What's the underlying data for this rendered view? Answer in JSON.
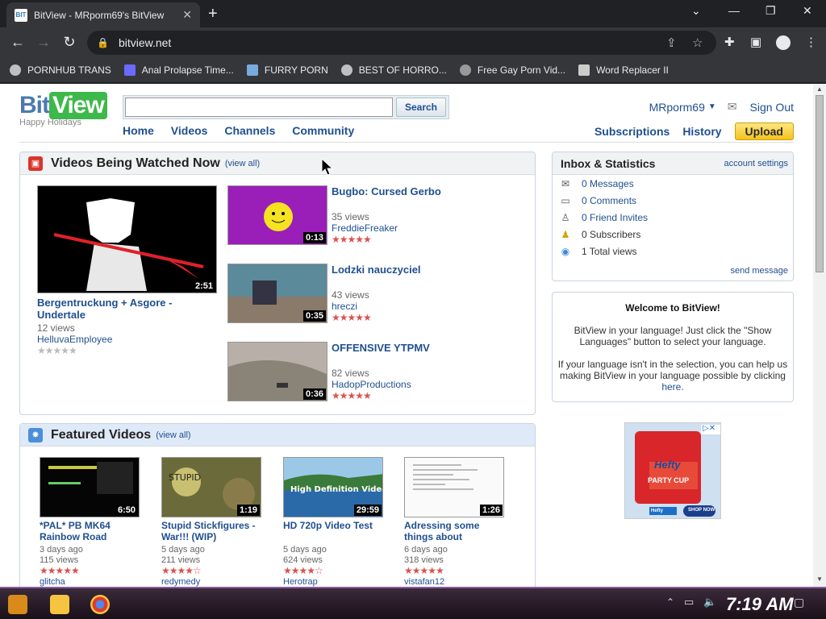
{
  "browser": {
    "tab_title": "BitView - MRporm69's BitView",
    "tab_favicon": "BIT",
    "url": "bitview.net",
    "bookmarks": [
      {
        "label": "PORNHUB TRANS",
        "icon": "globe-icon"
      },
      {
        "label": "Anal Prolapse Time...",
        "icon": "bookmark-icon"
      },
      {
        "label": "FURRY PORN",
        "icon": "bookmark-icon"
      },
      {
        "label": "BEST OF HORRO...",
        "icon": "globe-icon"
      },
      {
        "label": "Free Gay Porn Vid...",
        "icon": "bookmark-icon"
      },
      {
        "label": "Word Replacer II",
        "icon": "extension-icon"
      }
    ]
  },
  "site": {
    "logo_bit": "Bit",
    "logo_view": "View",
    "logo_tagline": "Happy Holidays",
    "search_button": "Search",
    "search_value": "",
    "nav": [
      "Home",
      "Videos",
      "Channels",
      "Community"
    ],
    "username": "MRporm69",
    "signout": "Sign Out",
    "subnav": {
      "subscriptions": "Subscriptions",
      "history": "History",
      "upload": "Upload"
    }
  },
  "watched": {
    "title": "Videos Being Watched Now",
    "viewall": "(view all)",
    "featured": {
      "title": "Bergentruckung + Asgore - Undertale",
      "duration": "2:51",
      "views": "12 views",
      "user": "HelluvaEmployee",
      "rating": 0
    },
    "items": [
      {
        "title": "Bugbo: Cursed Gerbo",
        "duration": "0:13",
        "views": "35 views",
        "user": "FreddieFreaker",
        "rating": 5
      },
      {
        "title": "Lodzki nauczyciel",
        "duration": "0:35",
        "views": "43 views",
        "user": "hreczi",
        "rating": 5
      },
      {
        "title": "OFFENSIVE YTPMV",
        "duration": "0:36",
        "views": "82 views",
        "user": "HadopProductions",
        "rating": 5
      }
    ]
  },
  "featured_videos": {
    "title": "Featured Videos",
    "viewall": "(view all)",
    "items": [
      {
        "title": "*PAL* PB MK64 Rainbow Road",
        "duration": "6:50",
        "age": "3 days ago",
        "views": "115 views",
        "user": "glitcha",
        "rating": 5
      },
      {
        "title": "Stupid Stickfigures - War!!! (WIP)",
        "duration": "1:19",
        "age": "5 days ago",
        "views": "211 views",
        "user": "redymedy",
        "rating": 4.5
      },
      {
        "title": "HD 720p Video Test",
        "duration": "29:59",
        "age": "5 days ago",
        "views": "624 views",
        "user": "Herotrap",
        "rating": 4.5
      },
      {
        "title": "Adressing some things about",
        "duration": "1:26",
        "age": "6 days ago",
        "views": "318 views",
        "user": "vistafan12",
        "rating": 5
      }
    ]
  },
  "inbox": {
    "title": "Inbox & Statistics",
    "settings": "account settings",
    "rows": [
      {
        "label": "0 Messages",
        "icon": "envelope-icon"
      },
      {
        "label": "0 Comments",
        "icon": "comment-icon"
      },
      {
        "label": "0 Friend Invites",
        "icon": "person-icon"
      },
      {
        "label": "0 Subscribers",
        "icon": "subscriber-icon"
      },
      {
        "label": "1 Total views",
        "icon": "views-icon"
      }
    ],
    "send": "send message"
  },
  "welcome": {
    "title": "Welcome to BitView!",
    "p1": "BitView in your language! Just click the \"Show Languages\" button to select your language.",
    "p2": "If your language isn't in the selection, you can help us making BitView in your language possible by clicking",
    "link": "here."
  },
  "ad": {
    "brand": "Hefty",
    "product": "PARTY CUP",
    "cta": "SHOP NOW"
  },
  "taskbar": {
    "clock": "7:19 AM"
  }
}
